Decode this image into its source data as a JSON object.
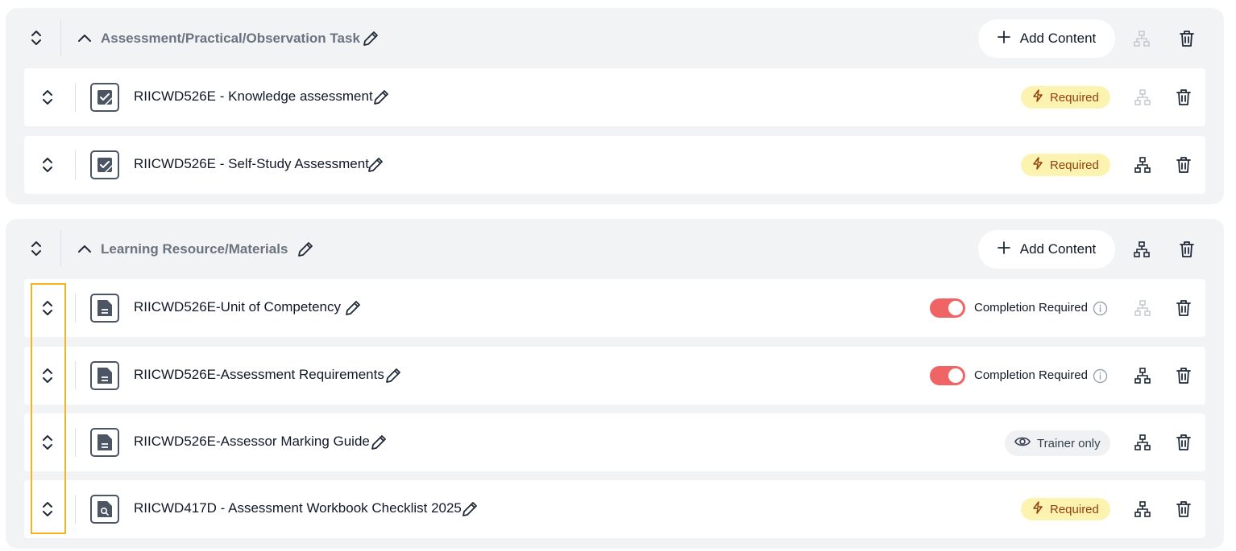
{
  "sections": [
    {
      "title": "Assessment/Practical/Observation Task",
      "add_label": "Add Content",
      "items": [
        {
          "title": "RIICWD526E - Knowledge assessment",
          "badge": "Required"
        },
        {
          "title": "RIICWD526E - Self-Study Assessment",
          "badge": "Required"
        }
      ]
    },
    {
      "title": "Learning Resource/Materials",
      "add_label": "Add Content",
      "items": [
        {
          "title": "RIICWD526E-Unit of Competency",
          "completion_label": "Completion Required"
        },
        {
          "title": "RIICWD526E-Assessment Requirements",
          "completion_label": "Completion Required"
        },
        {
          "title": "RIICWD526E-Assessor Marking Guide",
          "badge": "Trainer only"
        },
        {
          "title": "RIICWD417D - Assessment Workbook Checklist 2025",
          "badge": "Required"
        }
      ]
    }
  ],
  "icons": {
    "drag": "drag-handle-icon",
    "collapse": "chevron-up-icon",
    "edit": "pencil-icon",
    "add": "plus-icon",
    "hierarchy": "hierarchy-icon",
    "delete": "trash-icon",
    "assessment": "assessment-icon",
    "document": "document-icon",
    "checklist": "checklist-icon",
    "required": "lightning-icon",
    "trainer": "eye-icon",
    "info": "info-icon"
  },
  "colors": {
    "required_bg": "#fdf3b0",
    "required_text": "#92400e",
    "toggle_on": "#ef6464",
    "highlight": "#f6b31b",
    "section_bg": "#f2f3f5"
  }
}
